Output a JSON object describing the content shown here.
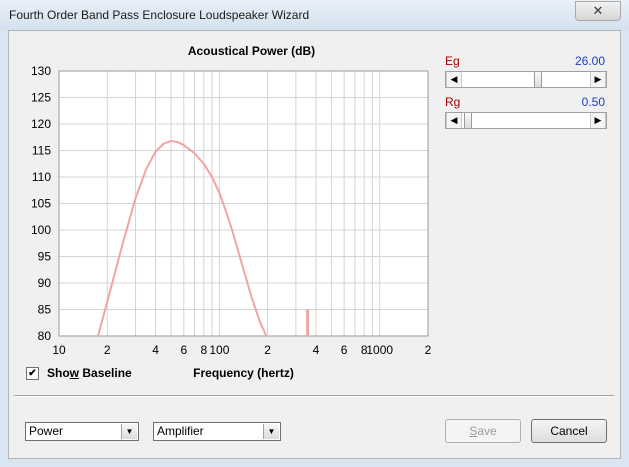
{
  "window": {
    "title": "Fourth Order Band Pass Enclosure Loudspeaker Wizard",
    "close_glyph": "✕"
  },
  "chart_data": {
    "type": "line",
    "title": "Acoustical Power (dB)",
    "xlabel": "Frequency (hertz)",
    "ylabel": "",
    "x_scale": "log",
    "xlim": [
      10,
      2000
    ],
    "ylim": [
      80,
      130
    ],
    "y_ticks": [
      80,
      85,
      90,
      95,
      100,
      105,
      110,
      115,
      120,
      125,
      130
    ],
    "x_tick_labels": [
      {
        "v": 10,
        "label": "10"
      },
      {
        "v": 20,
        "label": "2"
      },
      {
        "v": 40,
        "label": "4"
      },
      {
        "v": 60,
        "label": "6"
      },
      {
        "v": 80,
        "label": "8"
      },
      {
        "v": 100,
        "label": "100"
      },
      {
        "v": 200,
        "label": "2"
      },
      {
        "v": 400,
        "label": "4"
      },
      {
        "v": 600,
        "label": "6"
      },
      {
        "v": 800,
        "label": "8"
      },
      {
        "v": 1000,
        "label": "1000"
      },
      {
        "v": 2000,
        "label": "2"
      }
    ],
    "grid": true,
    "line_color": "#f4a3a3",
    "series": [
      {
        "x": [
          17.5,
          20,
          25,
          30,
          35,
          40,
          45,
          50,
          55,
          60,
          70,
          80,
          90,
          100,
          110,
          120,
          140,
          160,
          180,
          200,
          210
        ],
        "values": [
          80,
          86.5,
          97.5,
          106,
          111.5,
          114.8,
          116.3,
          116.8,
          116.6,
          116,
          114.5,
          112.5,
          110,
          107,
          103.5,
          100,
          93,
          87,
          82.5,
          79.5,
          78
        ]
      },
      {
        "x": [
          355,
          355
        ],
        "values": [
          80,
          85
        ]
      }
    ]
  },
  "controls": {
    "eg": {
      "label": "Eg",
      "value": "26.00",
      "position": 0.6
    },
    "rg": {
      "label": "Rg",
      "value": "0.50",
      "position": 0.03
    },
    "show_baseline": {
      "label_pre": "Sho",
      "label_key": "w",
      "label_post": " Baseline",
      "checked": true,
      "check_glyph": "✔"
    },
    "select_power": {
      "value": "Power"
    },
    "select_amplifier": {
      "value": "Amplifier"
    },
    "save_button": {
      "label_key": "S",
      "label_rest": "ave"
    },
    "cancel_button": {
      "label": "Cancel"
    },
    "arrow_left": "◀",
    "arrow_right": "▶",
    "arrow_down": "▼"
  },
  "colors": {
    "label_red": "#a00000",
    "value_blue": "#1f3fbf"
  }
}
